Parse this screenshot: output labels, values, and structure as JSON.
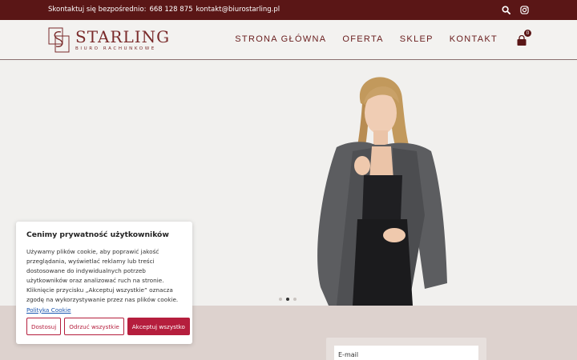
{
  "topbar": {
    "contact_label": "Skontaktuj się bezpośrednio:",
    "phone": "668 128 875",
    "email": "kontakt@biurostarling.pl",
    "icons": [
      "search-icon",
      "instagram-icon"
    ]
  },
  "header": {
    "logo_name": "STARLING",
    "logo_sub": "BIURO RACHUNKOWE",
    "nav": [
      "STRONA GŁÓWNA",
      "OFERTA",
      "SKLEP",
      "KONTAKT"
    ],
    "cart_count": "0"
  },
  "hero": {
    "slide_count": 3,
    "active_slide": 2
  },
  "newsletter": {
    "email_placeholder": "E-mail"
  },
  "cookie": {
    "title": "Cenimy prywatność użytkowników",
    "text": "Używamy plików cookie, aby poprawić jakość przeglądania, wyświetlać reklamy lub treści dostosowane do indywidualnych potrzeb użytkowników oraz analizować ruch na stronie. Kliknięcie przycisku „Akceptuj wszystkie” oznacza zgodę na wykorzystywanie przez nas plików cookie.",
    "link": "Polityka Cookie",
    "buttons": {
      "customize": "Dostosuj",
      "reject": "Odrzuć wszystkie",
      "accept": "Akceptuj wszystko"
    }
  },
  "colors": {
    "brand_dark": "#5a1616",
    "brand": "#7a2b2b",
    "accent_button": "#b51e3d",
    "link": "#1a56b0"
  }
}
